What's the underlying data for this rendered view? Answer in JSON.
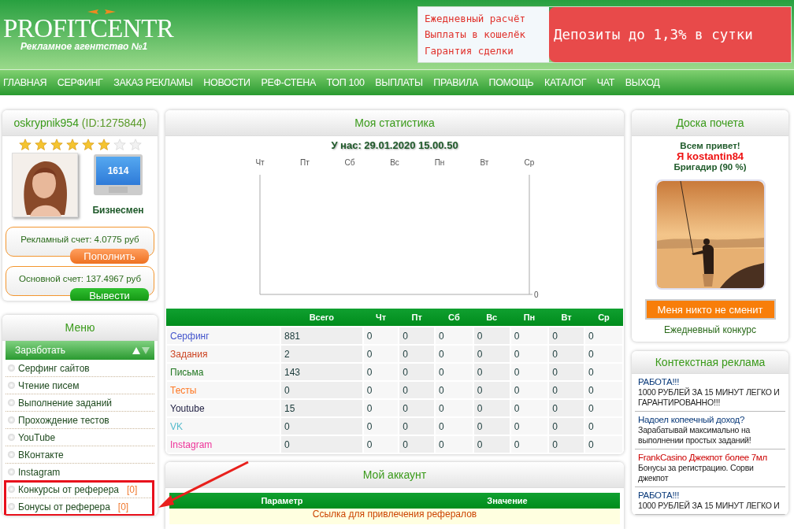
{
  "header": {
    "logo": "PROFITCENTR",
    "tagline": "Рекламное агентство №1",
    "banner": {
      "lines": [
        "Ежедневный расчёт",
        "Выплаты в кошелёк",
        "Гарантия сделки"
      ],
      "headline": "Депозиты до 1,3% в сутки"
    }
  },
  "nav": [
    "ГЛАВНАЯ",
    "СЕРФИНГ",
    "ЗАКАЗ РЕКЛАМЫ",
    "НОВОСТИ",
    "РЕФ-СТЕНА",
    "ТОП 100",
    "ВЫПЛАТЫ",
    "ПРАВИЛА",
    "ПОМОЩЬ",
    "КАТАЛОГ",
    "ЧАТ",
    "ВЫХОД"
  ],
  "profile": {
    "username": "oskrypnik954",
    "id": "(ID:1275844)",
    "stars": 6,
    "monitor_value": "1614",
    "status": "Бизнесмен",
    "accounts": [
      {
        "label": "Рекламный счет: 4.0775 руб",
        "button": "Пополнить",
        "kind": "deposit"
      },
      {
        "label": "Основной счет: 137.4967 руб",
        "button": "Вывести",
        "kind": "withdraw"
      }
    ]
  },
  "menu": {
    "title": "Меню",
    "section": "Заработать",
    "expanded": true,
    "items": [
      {
        "label": "Серфинг сайтов"
      },
      {
        "label": "Чтение писем"
      },
      {
        "label": "Выполнение заданий"
      },
      {
        "label": "Прохождение тестов"
      },
      {
        "label": "YouTube"
      },
      {
        "label": "ВКонтакте"
      },
      {
        "label": "Instagram"
      },
      {
        "label": "Конкурсы от реферера",
        "count": "[0]",
        "highlighted": true
      },
      {
        "label": "Бонусы от реферера",
        "count": "[0]",
        "highlighted": true
      }
    ]
  },
  "statistics": {
    "title": "Моя статистика",
    "timestamp": "У нас: 29.01.2020 15.00.50",
    "chart": {
      "kind": "frame",
      "day_labels": [
        "Чт",
        "Пт",
        "Сб",
        "Вс",
        "Пн",
        "Вт",
        "Ср"
      ]
    },
    "axis_value": "0",
    "table": {
      "columns": [
        "Всего",
        "Чт",
        "Пт",
        "Сб",
        "Вс",
        "Пн",
        "Вт",
        "Ср"
      ],
      "rows": [
        {
          "name": "Серфинг",
          "color": "#4455cc",
          "values": [
            "881",
            "0",
            "0",
            "0",
            "0",
            "0",
            "0",
            "0"
          ]
        },
        {
          "name": "Задания",
          "color": "#cc4422",
          "values": [
            "2",
            "0",
            "0",
            "0",
            "0",
            "0",
            "0",
            "0"
          ]
        },
        {
          "name": "Письма",
          "color": "#227722",
          "values": [
            "143",
            "0",
            "0",
            "0",
            "0",
            "0",
            "0",
            "0"
          ]
        },
        {
          "name": "Тесты",
          "color": "#ff7722",
          "values": [
            "0",
            "0",
            "0",
            "0",
            "0",
            "0",
            "0",
            "0"
          ]
        },
        {
          "name": "Youtube",
          "color": "#222244",
          "values": [
            "15",
            "0",
            "0",
            "0",
            "0",
            "0",
            "0",
            "0"
          ]
        },
        {
          "name": "VK",
          "color": "#55bbcc",
          "values": [
            "0",
            "0",
            "0",
            "0",
            "0",
            "0",
            "0",
            "0"
          ]
        },
        {
          "name": "Instagram",
          "color": "#ee3399",
          "values": [
            "0",
            "0",
            "0",
            "0",
            "0",
            "0",
            "0",
            "0"
          ]
        }
      ]
    }
  },
  "account": {
    "title": "Мой аккаунт",
    "columns": [
      "Параметр",
      "Значение"
    ],
    "first_row": "Ссылка для привлечения рефералов"
  },
  "honor_board": {
    "title": "Доска почета",
    "greeting": "Всем привет!",
    "name": "Я kostantin84",
    "rank": "Бригадир (90 %)",
    "button": "Меня никто не сменит",
    "caption": "Ежедневный конкурс"
  },
  "context_ads": {
    "title": "Контекстная реклама",
    "ads": [
      {
        "title": "РАБОТА!!!",
        "text": "1000 РУБЛЕЙ ЗА 15 МИНУТ ЛЕГКО И ГАРАНТИРОВАННО!!!",
        "color": "#0a3a7a"
      },
      {
        "title": "Надоел копеечный доход?",
        "text": "Зарабатывай максимально на выполнении простых заданий!",
        "color": "#0a3a7a"
      },
      {
        "title": "FrankCasino Джекпот более 7мл",
        "text": "Бонусы за регистрацию. Сорви джекпот",
        "color": "#cc0000"
      },
      {
        "title": "РАБОТА!!!",
        "text": "1000 РУБЛЕЙ ЗА 15 МИНУТ ЛЕГКО И",
        "color": "#0a3a7a"
      }
    ]
  }
}
